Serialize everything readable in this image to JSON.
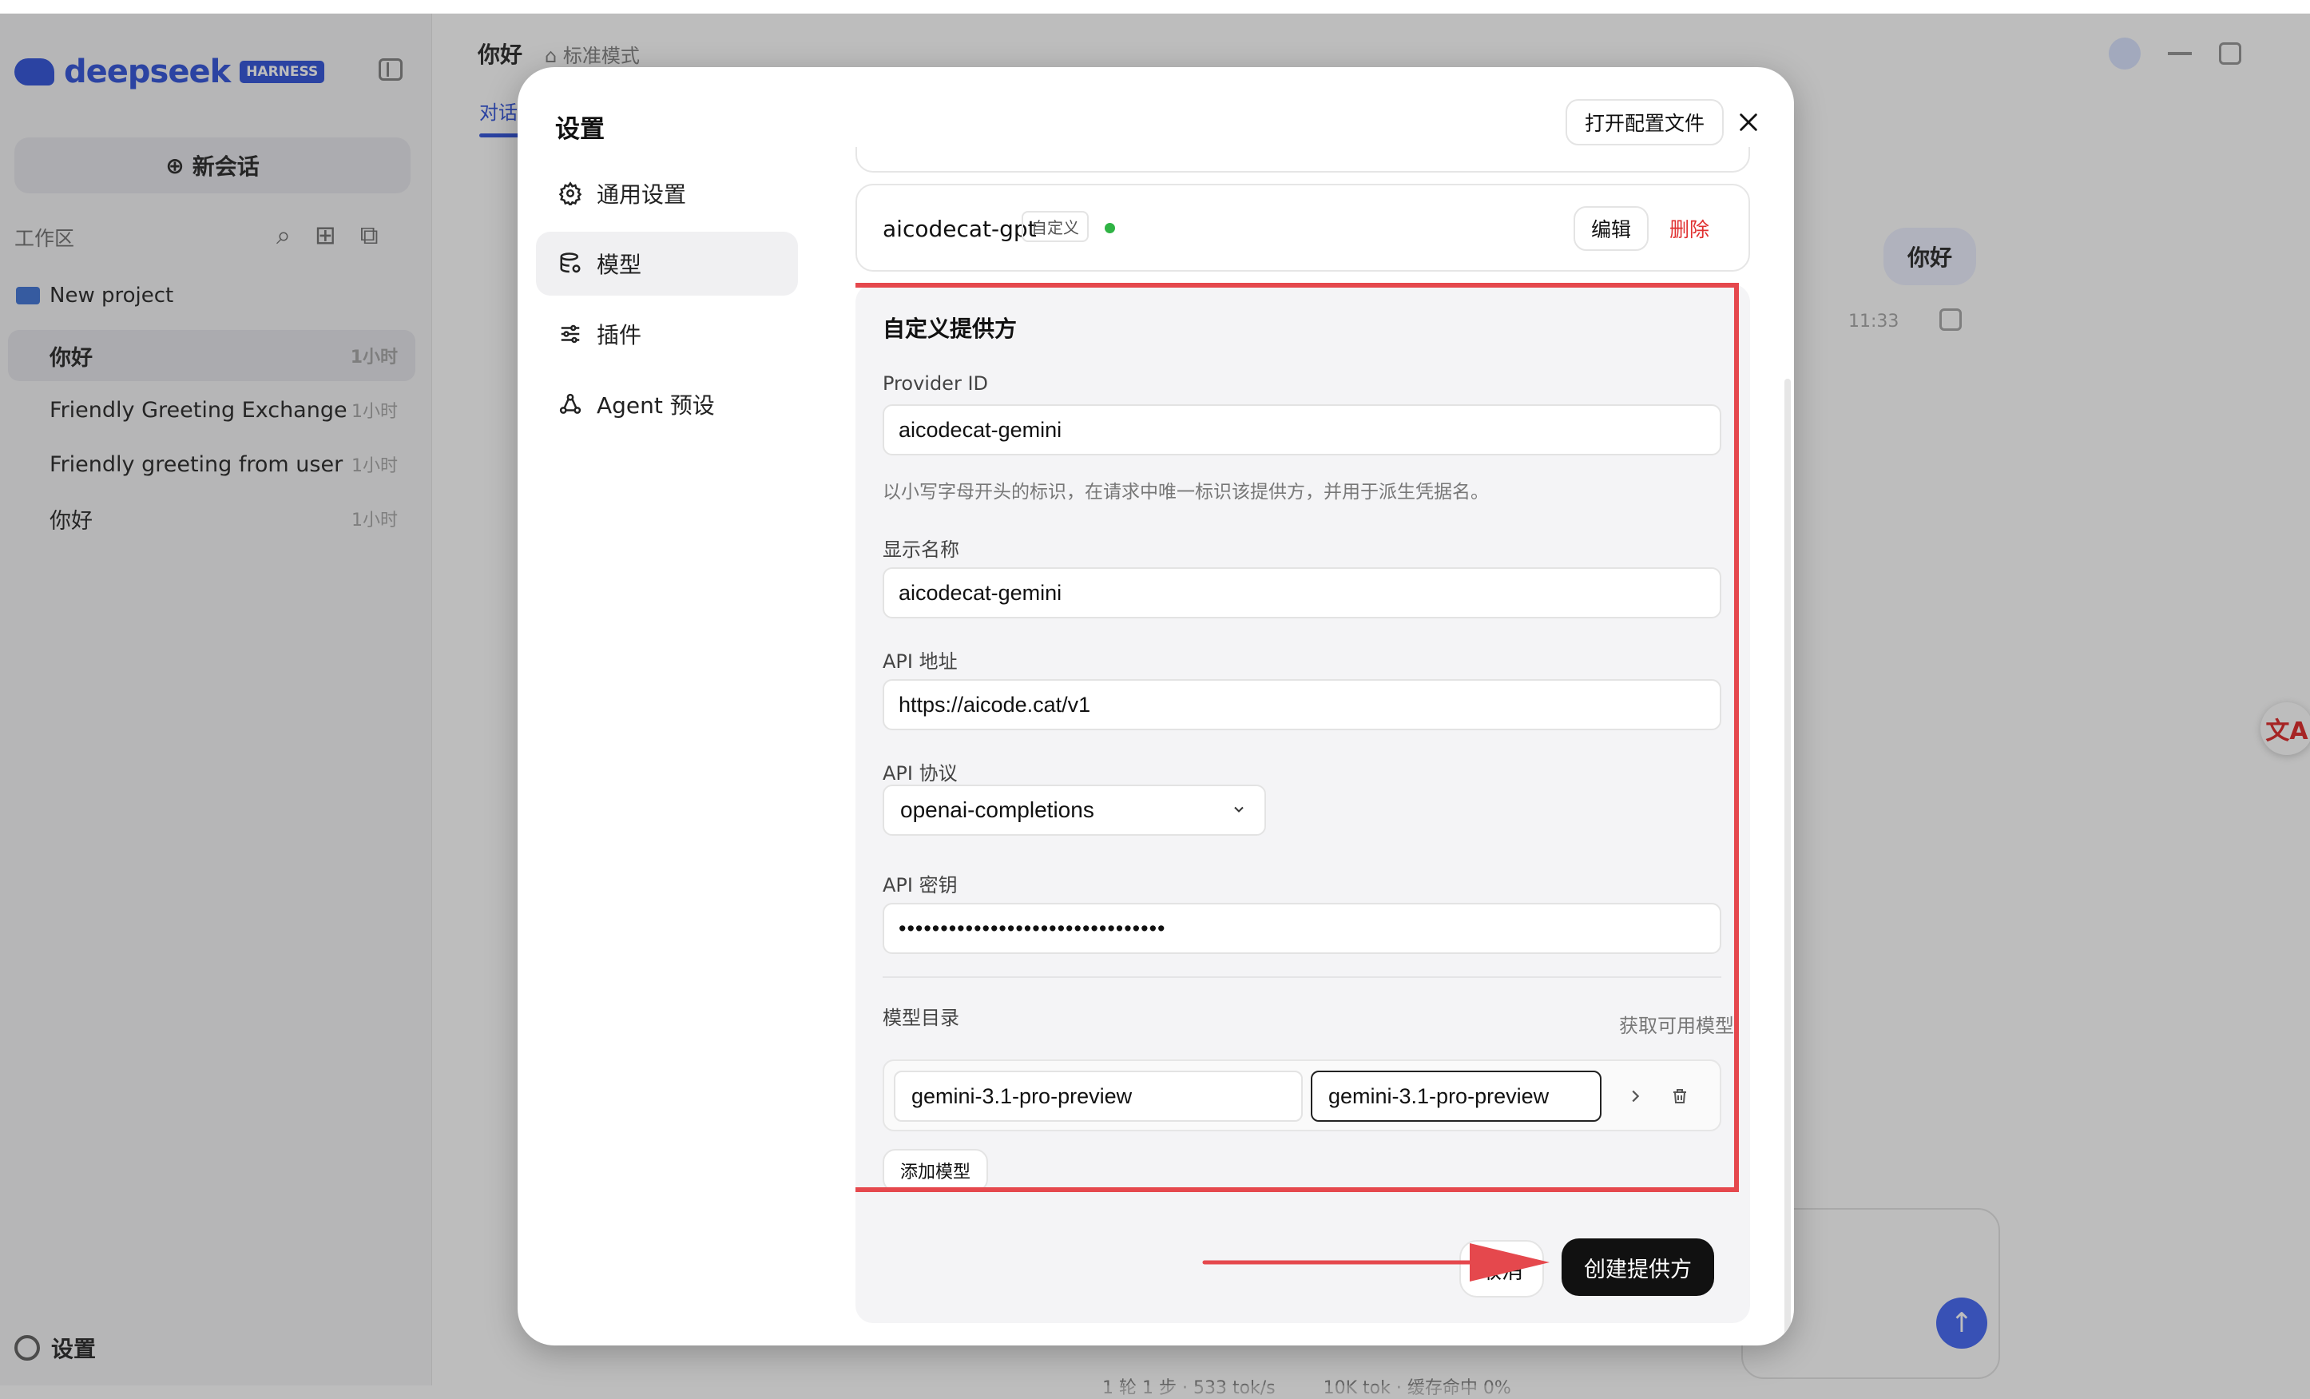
{
  "background": {
    "sidebar": {
      "logo_text": "deepseek",
      "logo_badge": "HARNESS",
      "new_chat": "新会话",
      "workspace_label": "工作区",
      "project": "New project",
      "conversations": [
        {
          "title": "你好",
          "time": "1小时"
        },
        {
          "title": "Friendly Greeting Exchange",
          "time": "1小时"
        },
        {
          "title": "Friendly greeting from user",
          "time": "1小时"
        },
        {
          "title": "你好",
          "time": "1小时"
        }
      ],
      "settings": "设置"
    },
    "chat": {
      "title": "你好",
      "mode": "标准模式",
      "tab": "对话",
      "bubble": "你好",
      "bubble_time": "11:33",
      "status_left": "1 轮 1 步 · 533 tok/s",
      "status_right": "10K tok · 缓存命中 0%"
    }
  },
  "modal": {
    "title": "设置",
    "open_config": "打开配置文件",
    "nav": [
      {
        "label": "通用设置",
        "icon": "gear-icon"
      },
      {
        "label": "模型",
        "icon": "database-icon"
      },
      {
        "label": "插件",
        "icon": "sliders-icon"
      },
      {
        "label": "Agent 预设",
        "icon": "agent-icon"
      }
    ],
    "active_nav": "模型",
    "provider": {
      "name": "aicodecat-gpt",
      "tag": "自定义",
      "status_color": "#2fb344",
      "edit": "编辑",
      "delete": "删除"
    },
    "form": {
      "section_title": "自定义提供方",
      "provider_id_label": "Provider ID",
      "provider_id_value": "aicodecat-gemini",
      "provider_id_hint": "以小写字母开头的标识，在请求中唯一标识该提供方，并用于派生凭据名。",
      "display_name_label": "显示名称",
      "display_name_value": "aicodecat-gemini",
      "api_url_label": "API 地址",
      "api_url_value": "https://aicode.cat/v1",
      "protocol_label": "API 协议",
      "protocol_value": "openai-completions",
      "api_key_label": "API 密钥",
      "api_key_value": "••••••••••••••••••••••••••••••••",
      "catalog_label": "模型目录",
      "fetch_models": "获取可用模型",
      "models": [
        {
          "id": "gemini-3.1-pro-preview",
          "name": "gemini-3.1-pro-preview"
        }
      ],
      "add_model": "添加模型",
      "cancel": "取消",
      "create": "创建提供方"
    },
    "highlight_color": "#e5484d"
  }
}
